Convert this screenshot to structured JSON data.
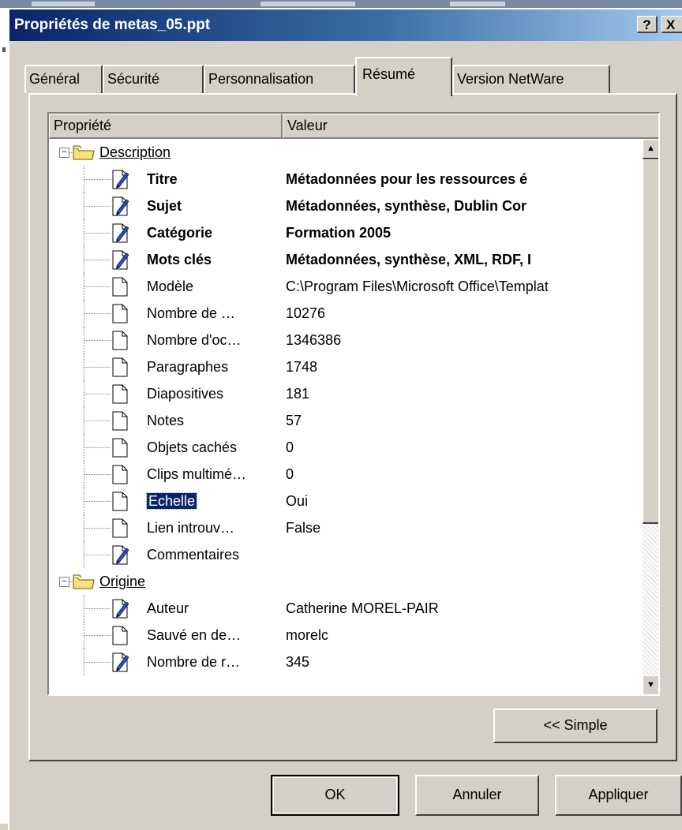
{
  "window": {
    "title": "Propriétés de metas_05.ppt",
    "help_label": "?",
    "close_label": "X"
  },
  "tabs": [
    {
      "label": "Général",
      "active": false
    },
    {
      "label": "Sécurité",
      "active": false
    },
    {
      "label": "Personnalisation",
      "active": false
    },
    {
      "label": "Résumé",
      "active": true
    },
    {
      "label": "Version NetWare",
      "active": false
    }
  ],
  "list": {
    "columns": [
      "Propriété",
      "Valeur"
    ],
    "rows": [
      {
        "kind": "group",
        "name": "Description",
        "value": "",
        "icon": "folder-icon",
        "expander": "−"
      },
      {
        "kind": "item",
        "name": "Titre",
        "value": "Métadonnées pour les ressources é",
        "icon": "edited-document-icon",
        "bold": true
      },
      {
        "kind": "item",
        "name": "Sujet",
        "value": "Métadonnées, synthèse, Dublin Cor",
        "icon": "edited-document-icon",
        "bold": true
      },
      {
        "kind": "item",
        "name": "Catégorie",
        "value": "Formation 2005",
        "icon": "edited-document-icon",
        "bold": true
      },
      {
        "kind": "item",
        "name": "Mots clés",
        "value": "Métadonnées, synthèse, XML, RDF, I",
        "icon": "edited-document-icon",
        "bold": true
      },
      {
        "kind": "item",
        "name": "Modèle",
        "value": "C:\\Program Files\\Microsoft Office\\Templat",
        "icon": "document-icon"
      },
      {
        "kind": "item",
        "name": "Nombre de …",
        "value": "10276",
        "icon": "document-icon"
      },
      {
        "kind": "item",
        "name": "Nombre d'oc…",
        "value": "1346386",
        "icon": "document-icon"
      },
      {
        "kind": "item",
        "name": "Paragraphes",
        "value": "1748",
        "icon": "document-icon"
      },
      {
        "kind": "item",
        "name": "Diapositives",
        "value": "181",
        "icon": "document-icon"
      },
      {
        "kind": "item",
        "name": "Notes",
        "value": "57",
        "icon": "document-icon"
      },
      {
        "kind": "item",
        "name": "Objets cachés",
        "value": "0",
        "icon": "document-icon"
      },
      {
        "kind": "item",
        "name": "Clips multimé…",
        "value": "0",
        "icon": "document-icon"
      },
      {
        "kind": "item",
        "name": "Echelle",
        "value": "Oui",
        "icon": "document-icon",
        "selected": true
      },
      {
        "kind": "item",
        "name": "Lien introuv…",
        "value": "False",
        "icon": "document-icon"
      },
      {
        "kind": "item",
        "name": "Commentaires",
        "value": "",
        "icon": "edited-document-icon"
      },
      {
        "kind": "group",
        "name": "Origine",
        "value": "",
        "icon": "folder-icon",
        "expander": "−"
      },
      {
        "kind": "item",
        "name": "Auteur",
        "value": "Catherine MOREL-PAIR",
        "icon": "edited-document-icon"
      },
      {
        "kind": "item",
        "name": "Sauvé en de…",
        "value": "morelc",
        "icon": "document-icon"
      },
      {
        "kind": "item",
        "name": "Nombre de r…",
        "value": "345",
        "icon": "edited-document-icon"
      }
    ]
  },
  "scrollbar": {
    "up": "▲",
    "down": "▼"
  },
  "buttons": {
    "simple": "<< Simple",
    "ok": "OK",
    "cancel": "Annuler",
    "apply": "Appliquer"
  }
}
